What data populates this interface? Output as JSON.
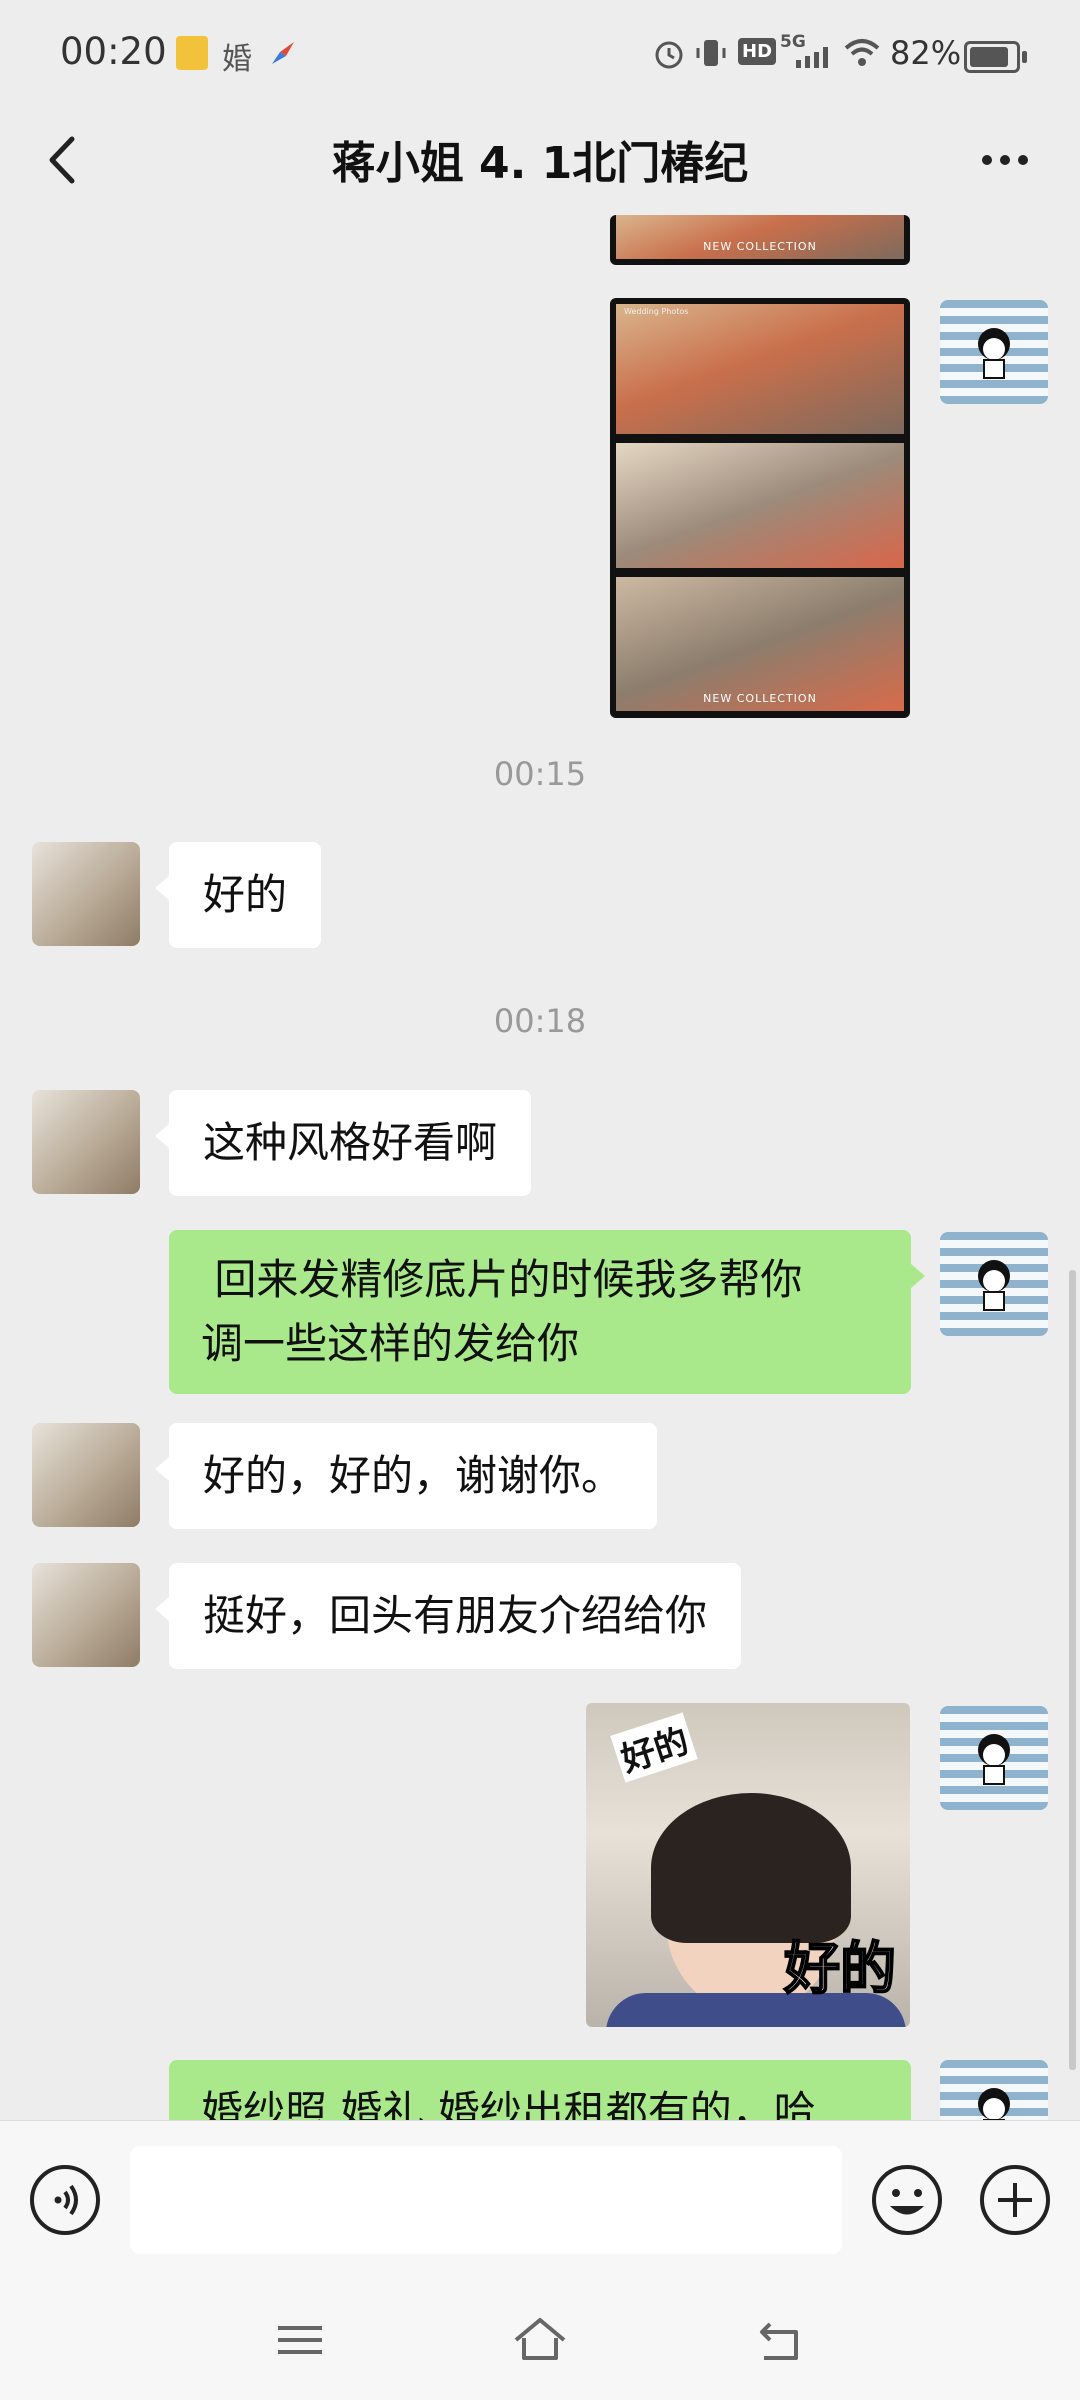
{
  "status_bar": {
    "time": "00:20",
    "left_icons": [
      "app-badge-icon",
      "hun-text-icon",
      "compass-icon"
    ],
    "hun_glyph": "婚",
    "right_icons": [
      "alarm-icon",
      "vibrate-icon",
      "hd-icon",
      "5g-signal-icon",
      "wifi-icon",
      "battery-icon"
    ],
    "hd_text": "HD",
    "network_text": "5G",
    "battery_percent": "82%"
  },
  "nav": {
    "title": "蒋小姐 4. 1北门椿纪",
    "back_icon": "chevron-left-icon",
    "more_icon": "more-dots-icon"
  },
  "messages": {
    "ts1": "00:15",
    "m1": "好的",
    "ts2": "00:18",
    "m2": "这种风格好看啊",
    "m3_line1": " 回来发精修底片的时候我多帮你",
    "m3_line2": "调一些这样的发给你",
    "m4": "好的，好的，谢谢你。",
    "m5": "挺好，回头有朋友介绍给你",
    "sticker_top_text": "好的",
    "sticker_bottom_text": "好的",
    "m6_partial": "婚纱照 婚礼 婚纱出租都有的，哈"
  },
  "photo": {
    "caption": "NEW COLLECTION",
    "frame_label": "Wedding Photos"
  },
  "input": {
    "voice_icon": "voice-icon",
    "emoji_icon": "emoji-icon",
    "plus_icon": "plus-icon",
    "placeholder": ""
  },
  "sys_nav": [
    "menu-icon",
    "home-icon",
    "back-icon"
  ]
}
